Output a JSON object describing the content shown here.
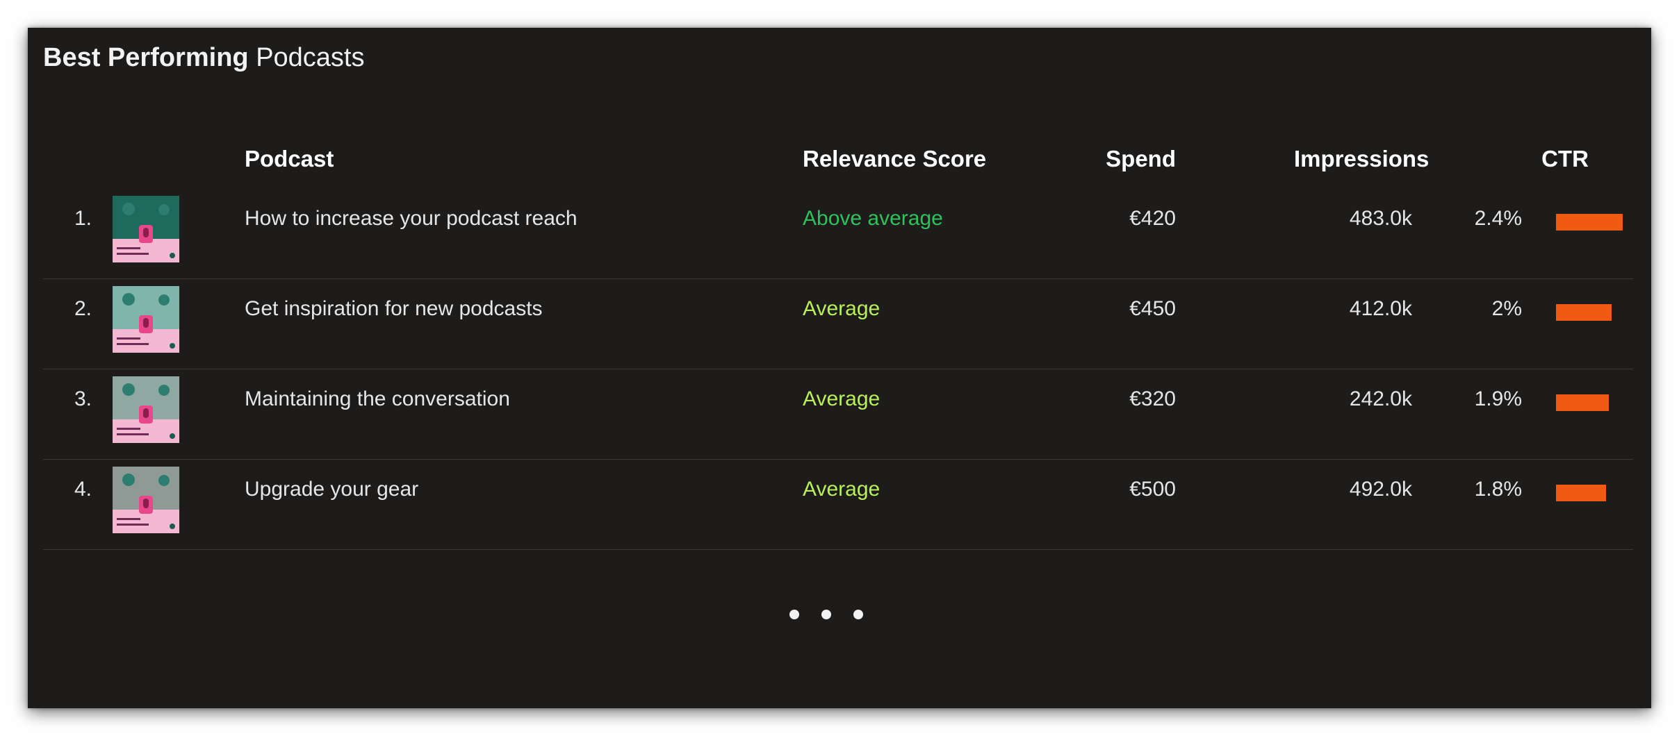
{
  "title": {
    "bold": "Best Performing",
    "light": "Podcasts"
  },
  "columns": {
    "podcast": "Podcast",
    "relevance": "Relevance Score",
    "spend": "Spend",
    "impressions": "Impressions",
    "ctr": "CTR"
  },
  "colors": {
    "above_average": "#2fc15a",
    "average": "#b8ef5a",
    "ctr_bar": "#f05a13",
    "background": "#1d1c1b"
  },
  "rows": [
    {
      "rank": "1.",
      "podcast": "How to increase your podcast reach",
      "relevance": "Above average",
      "spend": "€420",
      "impressions": "483.0k",
      "ctr": "2.4%",
      "ctr_value": 2.4
    },
    {
      "rank": "2.",
      "podcast": "Get inspiration for new podcasts",
      "relevance": "Average",
      "spend": "€450",
      "impressions": "412.0k",
      "ctr": "2%",
      "ctr_value": 2.0
    },
    {
      "rank": "3.",
      "podcast": "Maintaining the conversation",
      "relevance": "Average",
      "spend": "€320",
      "impressions": "242.0k",
      "ctr": "1.9%",
      "ctr_value": 1.9
    },
    {
      "rank": "4.",
      "podcast": "Upgrade your gear",
      "relevance": "Average",
      "spend": "€500",
      "impressions": "492.0k",
      "ctr": "1.8%",
      "ctr_value": 1.8
    }
  ],
  "thumbnails": [
    {
      "icon": "podcast-cover-microphone-icon",
      "scene_color": "#1e6b5e"
    },
    {
      "icon": "podcast-cover-inspiration-icon",
      "scene_color": "#7fb5aa"
    },
    {
      "icon": "podcast-cover-conversation-icon",
      "scene_color": "#8fa8a2"
    },
    {
      "icon": "podcast-cover-gear-icon",
      "scene_color": "#8f9a97"
    }
  ],
  "pagination": {
    "dots": 3
  }
}
